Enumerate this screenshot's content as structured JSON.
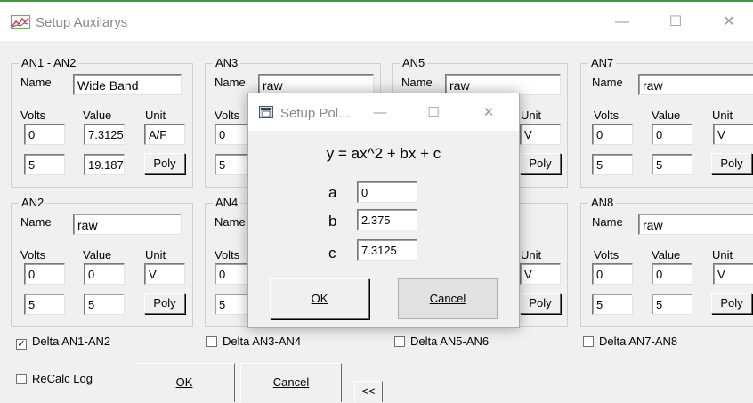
{
  "window": {
    "title": "Setup Auxilarys",
    "minimize": "—",
    "maximize": "☐",
    "close": "✕",
    "icon": "chart-icon"
  },
  "groups": {
    "an1": {
      "title": "AN1 - AN2",
      "name_label": "Name",
      "name": "Wide Band",
      "volts_label": "Volts",
      "value_label": "Value",
      "unit_label": "Unit",
      "v1": "0",
      "val1": "7.3125",
      "unit": "A/F",
      "v2": "5",
      "val2": "19.187",
      "poly": "Poly"
    },
    "an3": {
      "title": "AN3",
      "name_label": "Name",
      "name": "raw",
      "volts_label": "Volts",
      "v1": "0",
      "v2": "5"
    },
    "an5": {
      "title": "AN5",
      "name_label": "Name",
      "name": "raw",
      "unit_label": "Unit",
      "unit": "V",
      "poly": "Poly"
    },
    "an7": {
      "title": "AN7",
      "name_label": "Name",
      "name": "raw",
      "volts_label": "Volts",
      "value_label": "Value",
      "unit_label": "Unit",
      "v1": "0",
      "val1": "0",
      "unit": "V",
      "v2": "5",
      "val2": "5",
      "poly": "Poly"
    },
    "an2": {
      "title": "AN2",
      "name_label": "Name",
      "name": "raw",
      "volts_label": "Volts",
      "value_label": "Value",
      "unit_label": "Unit",
      "v1": "0",
      "val1": "0",
      "unit": "V",
      "v2": "5",
      "val2": "5",
      "poly": "Poly"
    },
    "an4": {
      "title": "AN4",
      "name_label": "Name",
      "volts_label": "Volts",
      "v1": "0",
      "v2": "5"
    },
    "an6": {
      "unit_label": "Unit",
      "unit": "V",
      "poly": "Poly"
    },
    "an8": {
      "title": "AN8",
      "name_label": "Name",
      "name": "raw",
      "volts_label": "Volts",
      "value_label": "Value",
      "unit_label": "Unit",
      "v1": "0",
      "val1": "0",
      "unit": "V",
      "v2": "5",
      "val2": "5",
      "poly": "Poly"
    }
  },
  "delta": [
    {
      "label": "Delta  AN1-AN2",
      "checked": true,
      "mark": "✓"
    },
    {
      "label": "Delta  AN3-AN4",
      "checked": false
    },
    {
      "label": "Delta  AN5-AN6",
      "checked": false
    },
    {
      "label": "Delta  AN7-AN8",
      "checked": false
    }
  ],
  "recalc": {
    "label": "ReCalc Log",
    "checked": false
  },
  "buttons": {
    "ok": "OK",
    "cancel": "Cancel",
    "collapse": "<<"
  },
  "dialog": {
    "title": "Setup Pol...",
    "minimize": "—",
    "maximize": "☐",
    "close": "✕",
    "formula": "y = ax^2 + bx + c",
    "a_label": "a",
    "a": "0",
    "b_label": "b",
    "b": "2.375",
    "c_label": "c",
    "c": "7.3125",
    "ok": "OK",
    "cancel": "Cancel"
  }
}
